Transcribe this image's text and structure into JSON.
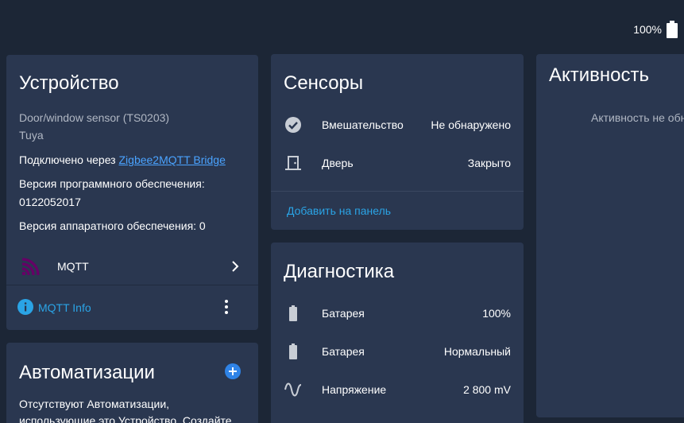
{
  "topbar": {
    "battery_level": "100%",
    "battery_icon": "battery-full-icon"
  },
  "device": {
    "title": "Устройство",
    "model": "Door/window sensor (TS0203)",
    "manufacturer": "Tuya",
    "connected_via_prefix": "Подключено через ",
    "connected_via_link": "Zigbee2MQTT Bridge",
    "firmware_label": "Версия программного обеспечения:",
    "firmware_value": "0122052017",
    "hardware_label": "Версия аппаратного обеспечения: 0",
    "integration": {
      "label": "MQTT",
      "icon": "mqtt-logo-icon"
    },
    "info_link": "MQTT Info"
  },
  "automations": {
    "title": "Автоматизации",
    "empty_line1": "Отсутствуют Автоматизации,",
    "empty_line2": "использующие это Устройство. Создайте"
  },
  "sensors": {
    "title": "Сенсоры",
    "items": [
      {
        "name": "Вмешательство",
        "value": "Не обнаружено",
        "icon": "check-circle-icon"
      },
      {
        "name": "Дверь",
        "value": "Закрыто",
        "icon": "door-closed-icon"
      }
    ],
    "add_to_panel": "Добавить на панель"
  },
  "diagnostics": {
    "title": "Диагностика",
    "items": [
      {
        "name": "Батарея",
        "value": "100%",
        "icon": "battery-icon"
      },
      {
        "name": "Батарея",
        "value": "Нормальный",
        "icon": "battery-icon"
      },
      {
        "name": "Напряжение",
        "value": "2 800 mV",
        "icon": "sine-wave-icon"
      }
    ]
  },
  "activity": {
    "title": "Активность",
    "empty": "Активность не обнаружена"
  },
  "colors": {
    "background": "#1c2636",
    "card": "#2a3750",
    "link": "#4aa3ff",
    "accent": "#2aa4e6",
    "mqtt_brand": "#660066"
  }
}
